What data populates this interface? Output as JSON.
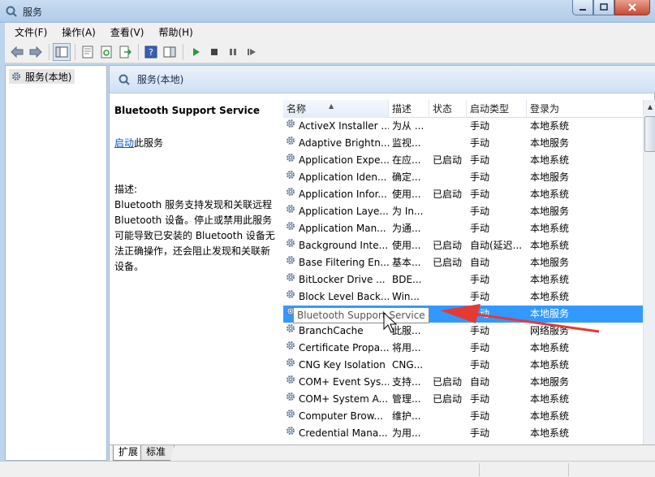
{
  "window": {
    "title": "服务",
    "minimize_icon": "minimize-icon",
    "maximize_icon": "maximize-icon",
    "close_icon": "close-icon"
  },
  "menu": [
    "文件(F)",
    "操作(A)",
    "查看(V)",
    "帮助(H)"
  ],
  "toolbar_icons": [
    "back-arrow-icon",
    "forward-arrow-icon",
    "show-hide-tree-icon",
    "properties-icon",
    "refresh-icon",
    "export-list-icon",
    "help-icon",
    "action-pane-icon",
    "start-service-icon",
    "stop-service-icon",
    "pause-service-icon",
    "restart-service-icon"
  ],
  "tree": {
    "root_label": "服务(本地)"
  },
  "pane_header": {
    "title": "服务(本地)"
  },
  "details": {
    "service_name": "Bluetooth Support Service",
    "start_link": "启动",
    "start_suffix": "此服务",
    "desc_label": "描述:",
    "desc_text": "Bluetooth 服务支持发现和关联远程 Bluetooth 设备。停止或禁用此服务可能导致已安装的 Bluetooth 设备无法正确操作，还会阻止发现和关联新设备。"
  },
  "columns": {
    "name": "名称",
    "desc": "描述",
    "state": "状态",
    "startup": "启动类型",
    "logon": "登录为"
  },
  "rows": [
    {
      "name": "ActiveX Installer ...",
      "desc": "为从 ...",
      "state": "",
      "startup": "手动",
      "logon": "本地系统"
    },
    {
      "name": "Adaptive Brightn...",
      "desc": "监视...",
      "state": "",
      "startup": "手动",
      "logon": "本地服务"
    },
    {
      "name": "Application Expe...",
      "desc": "在应...",
      "state": "已启动",
      "startup": "手动",
      "logon": "本地系统"
    },
    {
      "name": "Application Iden...",
      "desc": "确定...",
      "state": "",
      "startup": "手动",
      "logon": "本地服务"
    },
    {
      "name": "Application Infor...",
      "desc": "使用...",
      "state": "已启动",
      "startup": "手动",
      "logon": "本地系统"
    },
    {
      "name": "Application Laye...",
      "desc": "为 In...",
      "state": "",
      "startup": "手动",
      "logon": "本地服务"
    },
    {
      "name": "Application Man...",
      "desc": "为通...",
      "state": "",
      "startup": "手动",
      "logon": "本地系统"
    },
    {
      "name": "Background Inte...",
      "desc": "使用...",
      "state": "已启动",
      "startup": "自动(延迟...",
      "logon": "本地系统"
    },
    {
      "name": "Base Filtering En...",
      "desc": "基本...",
      "state": "已启动",
      "startup": "自动",
      "logon": "本地服务"
    },
    {
      "name": "BitLocker Drive ...",
      "desc": "BDE...",
      "state": "",
      "startup": "手动",
      "logon": "本地系统"
    },
    {
      "name": "Block Level Back...",
      "desc": "Win...",
      "state": "",
      "startup": "手动",
      "logon": "本地系统"
    },
    {
      "name": "Bluetooth Support Service",
      "desc": "",
      "state": "",
      "startup": "手动",
      "logon": "本地服务",
      "selected": true
    },
    {
      "name": "BranchCache",
      "desc": "此服...",
      "state": "",
      "startup": "手动",
      "logon": "网络服务"
    },
    {
      "name": "Certificate Propa...",
      "desc": "将用...",
      "state": "",
      "startup": "手动",
      "logon": "本地系统"
    },
    {
      "name": "CNG Key Isolation",
      "desc": "CNG...",
      "state": "",
      "startup": "手动",
      "logon": "本地系统"
    },
    {
      "name": "COM+ Event Sys...",
      "desc": "支持...",
      "state": "已启动",
      "startup": "自动",
      "logon": "本地服务"
    },
    {
      "name": "COM+ System A...",
      "desc": "管理...",
      "state": "已启动",
      "startup": "手动",
      "logon": "本地系统"
    },
    {
      "name": "Computer Brow...",
      "desc": "维护...",
      "state": "",
      "startup": "手动",
      "logon": "本地系统"
    },
    {
      "name": "Credential Mana...",
      "desc": "为用...",
      "state": "",
      "startup": "手动",
      "logon": "本地系统"
    }
  ],
  "tooltip": "Bluetooth Support Service",
  "tabs": [
    "扩展",
    "标准"
  ],
  "colors": {
    "selection": "#3399ff",
    "link": "#0b55c4",
    "annotation_arrow": "#e53935"
  }
}
